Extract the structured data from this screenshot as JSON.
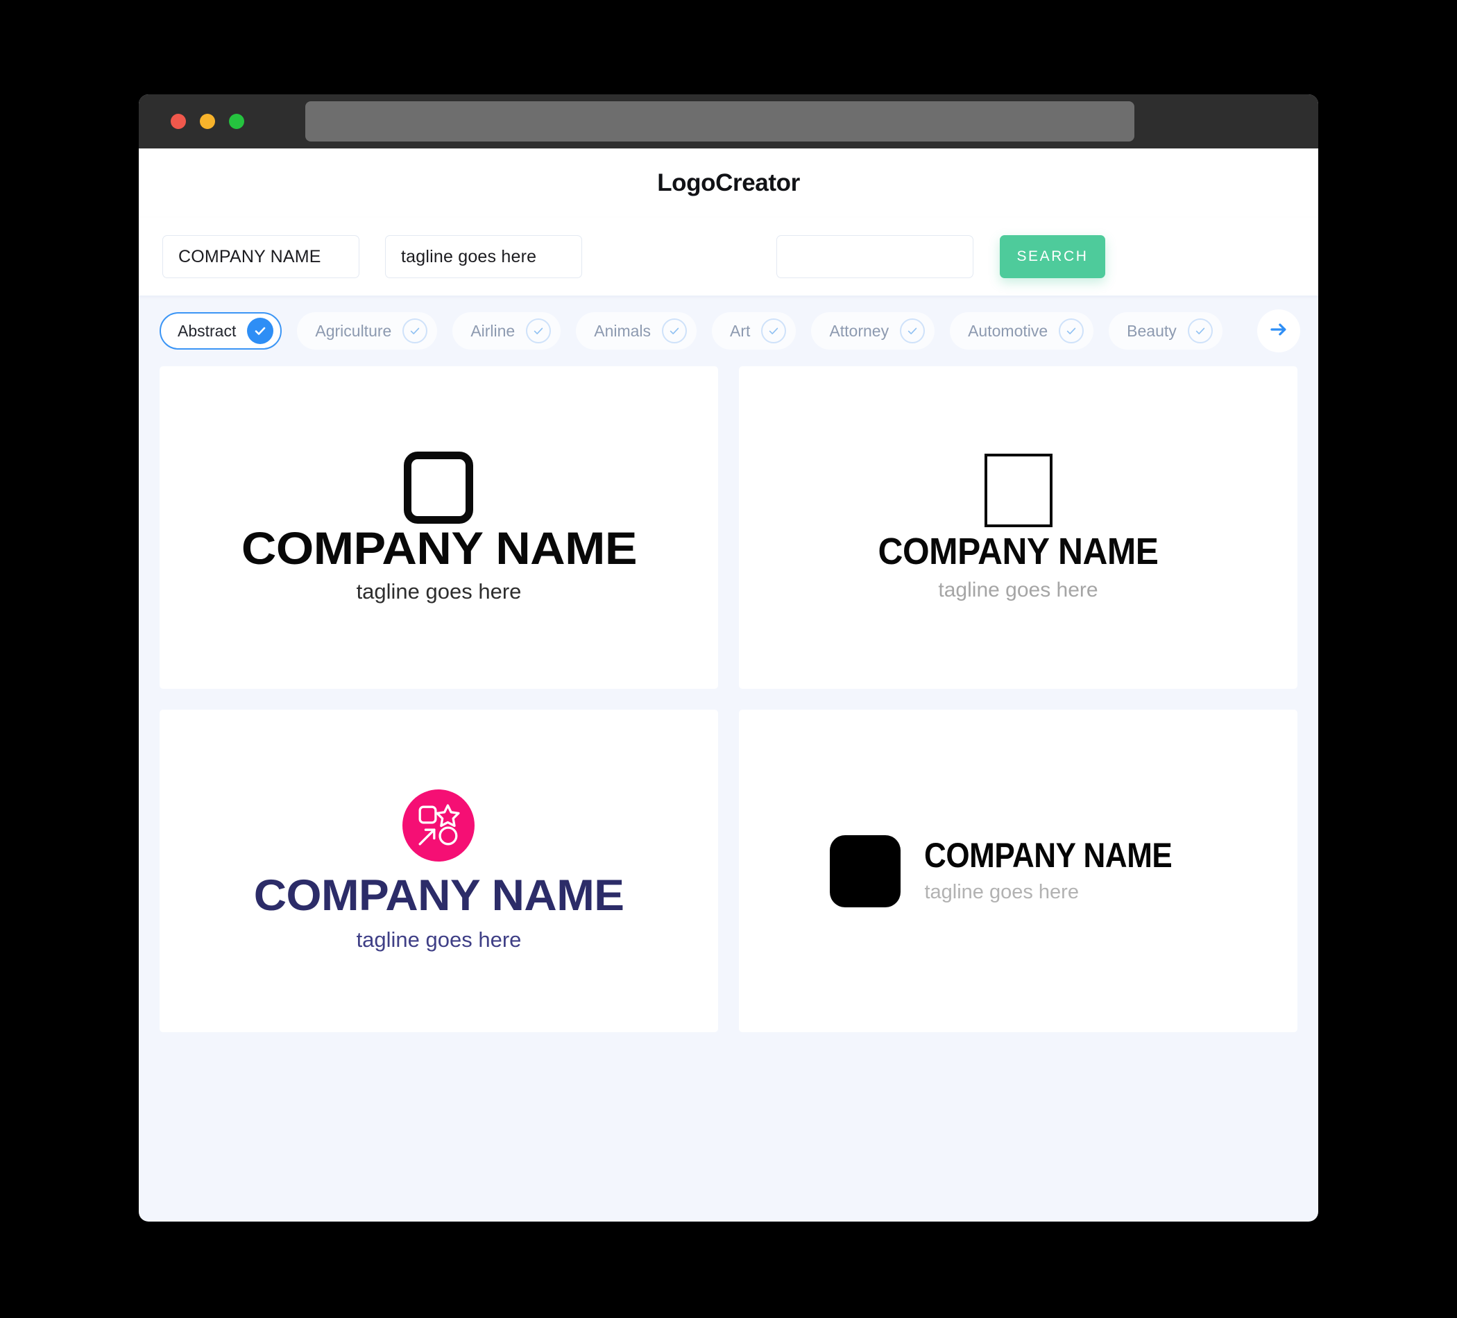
{
  "window": {
    "traffic_lights": [
      {
        "name": "close",
        "color": "#f0584c"
      },
      {
        "name": "minimize",
        "color": "#f7b32b"
      },
      {
        "name": "maximize",
        "color": "#25c33f"
      }
    ],
    "url_bar_value": ""
  },
  "header": {
    "title": "LogoCreator"
  },
  "search": {
    "company_name_value": "COMPANY NAME",
    "company_name_placeholder": "COMPANY NAME",
    "tagline_value": "tagline goes here",
    "tagline_placeholder": "tagline goes here",
    "extra_value": "",
    "extra_placeholder": "",
    "search_label": "SEARCH",
    "accent_color": "#4ecb9b"
  },
  "categories": {
    "next_icon": "arrow-right-icon",
    "active_color": "#2e8ef5",
    "items": [
      {
        "label": "Abstract",
        "selected": true
      },
      {
        "label": "Agriculture",
        "selected": false
      },
      {
        "label": "Airline",
        "selected": false
      },
      {
        "label": "Animals",
        "selected": false
      },
      {
        "label": "Art",
        "selected": false
      },
      {
        "label": "Attorney",
        "selected": false
      },
      {
        "label": "Automotive",
        "selected": false
      },
      {
        "label": "Beauty",
        "selected": false
      }
    ]
  },
  "logos": [
    {
      "id": 1,
      "mark": "rounded-square-outline-icon",
      "name": "COMPANY NAME",
      "tagline": "tagline goes here",
      "name_color": "#080808",
      "tagline_color": "#2d2d2d",
      "layout": "stacked"
    },
    {
      "id": 2,
      "mark": "square-outline-icon",
      "name": "COMPANY NAME",
      "tagline": "tagline goes here",
      "name_color": "#080808",
      "tagline_color": "#a5a5a5",
      "layout": "stacked"
    },
    {
      "id": 3,
      "mark": "pink-circle-shapes-icon",
      "name": "COMPANY NAME",
      "tagline": "tagline goes here",
      "name_color": "#2c2c68",
      "tagline_color": "#3f3f86",
      "mark_color": "#f50f74",
      "layout": "stacked"
    },
    {
      "id": 4,
      "mark": "black-rounded-square-icon",
      "name": "COMPANY NAME",
      "tagline": "tagline goes here",
      "name_color": "#050505",
      "tagline_color": "#b2b2b2",
      "mark_color": "#000000",
      "layout": "horizontal"
    }
  ]
}
